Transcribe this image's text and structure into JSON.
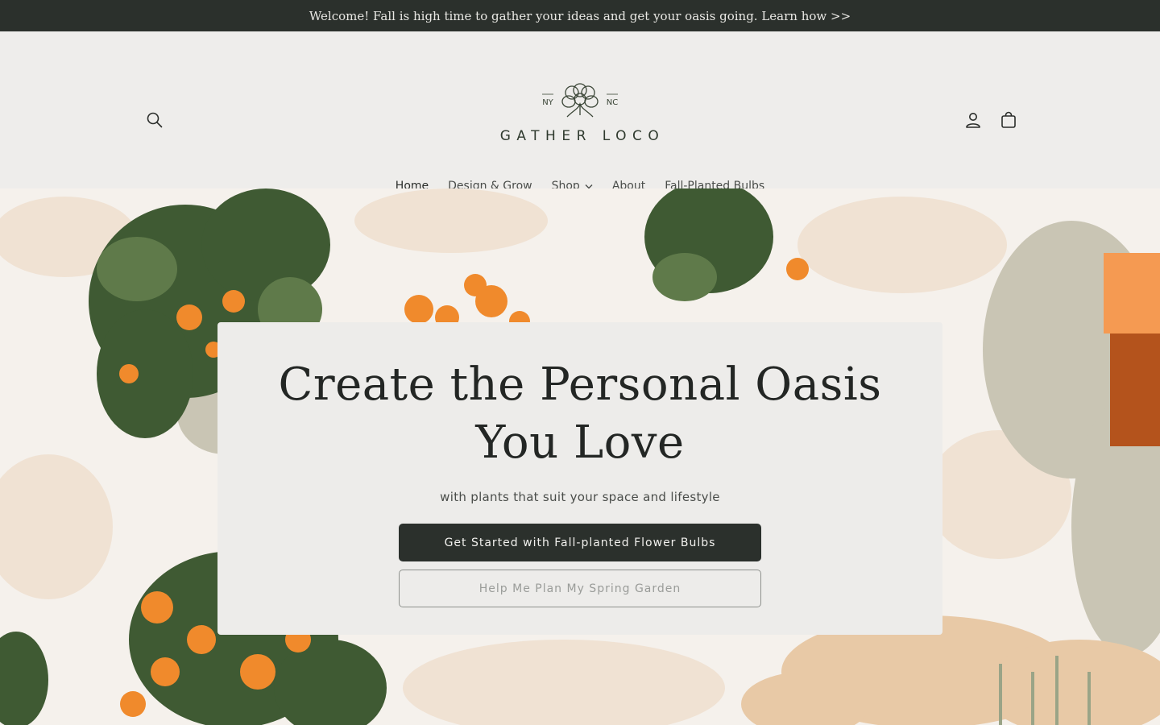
{
  "announcement": {
    "text": "Welcome! Fall is high time to gather your ideas and get your oasis going. Learn how >>"
  },
  "header": {
    "logo": {
      "text": "GATHER LOCO",
      "left_badge": "NY",
      "right_badge": "NC"
    },
    "icons": {
      "search": "search-icon",
      "account": "user-icon",
      "cart": "shopping-bag-icon"
    }
  },
  "nav": {
    "items": [
      {
        "label": "Home",
        "active": true
      },
      {
        "label": "Design & Grow"
      },
      {
        "label": "Shop",
        "has_dropdown": true
      },
      {
        "label": "About"
      },
      {
        "label": "Fall-Planted Bulbs"
      }
    ]
  },
  "hero": {
    "title": "Create the Personal Oasis You Love",
    "subtitle": "with plants that suit your space and lifestyle",
    "primary_button": "Get Started with Fall-planted Flower Bulbs",
    "secondary_button": "Help Me Plan My Spring Garden"
  },
  "colors": {
    "dark": "#2b302c",
    "background": "#eeedeb",
    "accent_orange": "#f08a2c",
    "foliage_green": "#3f5a33"
  }
}
